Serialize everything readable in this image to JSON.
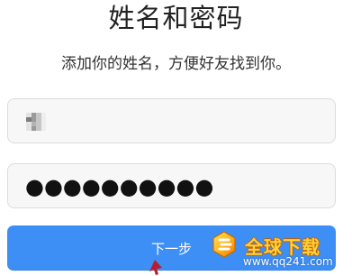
{
  "header": {
    "title": "姓名和密码",
    "subtitle": "添加你的姓名，方便好友找到你。"
  },
  "form": {
    "name_field": {
      "value": "",
      "redacted": true
    },
    "password_field": {
      "value": "●●●●●●●●●●"
    },
    "next_button_label": "下一步"
  },
  "watermark": {
    "title": "全球下载",
    "url": "www.qq241.com"
  },
  "colors": {
    "button": "#3d8ff6",
    "field_background": "#f7f7f7",
    "watermark_yellow": "#ffd23b"
  }
}
